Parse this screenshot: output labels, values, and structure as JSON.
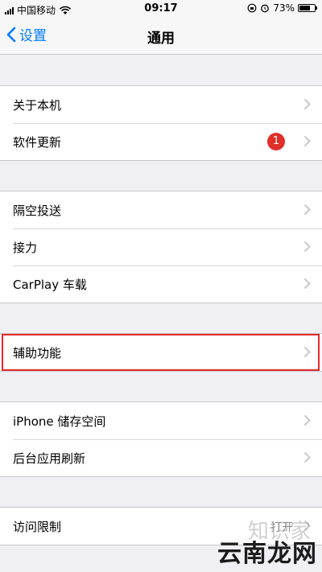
{
  "status_bar": {
    "carrier": "中国移动",
    "time": "09:17",
    "battery": "73%",
    "battery_level": 0.73
  },
  "nav": {
    "back_label": "设置",
    "title": "通用"
  },
  "groups": [
    {
      "items": [
        {
          "label": "关于本机"
        },
        {
          "label": "软件更新",
          "badge": "1"
        }
      ]
    },
    {
      "items": [
        {
          "label": "隔空投送"
        },
        {
          "label": "接力"
        },
        {
          "label": "CarPlay 车载"
        }
      ]
    },
    {
      "items": [
        {
          "label": "辅助功能"
        }
      ]
    },
    {
      "items": [
        {
          "label": "iPhone 储存空间"
        },
        {
          "label": "后台应用刷新"
        }
      ]
    },
    {
      "items": [
        {
          "label": "访问限制",
          "value": "打开"
        }
      ]
    }
  ],
  "watermark": {
    "text": "云南龙网",
    "faint_text": "知识家"
  }
}
